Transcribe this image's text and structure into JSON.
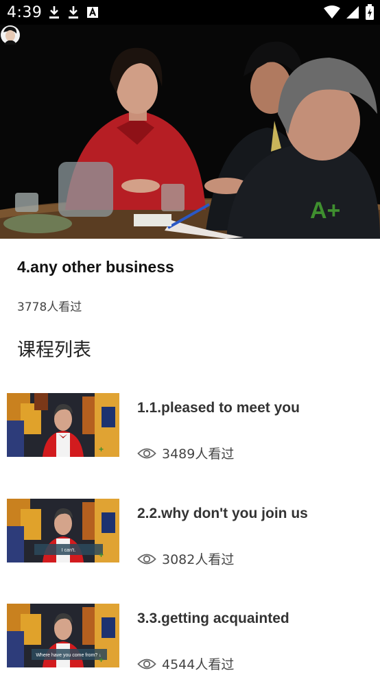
{
  "status_bar": {
    "time": "4:39",
    "left_icons": [
      "download-icon",
      "download-icon",
      "text-app-icon"
    ],
    "right_icons": [
      "wifi-icon",
      "signal-icon",
      "battery-icon"
    ]
  },
  "video": {
    "watermark": "A+"
  },
  "course": {
    "title": "4.any other business",
    "views": "3778人看过"
  },
  "section": {
    "title": "课程列表"
  },
  "lessons": [
    {
      "title": "1.1.pleased to meet you",
      "views": "3489人看过",
      "caption": ""
    },
    {
      "title": "2.2.why don't you join us",
      "views": "3082人看过",
      "caption": "I can't."
    },
    {
      "title": "3.3.getting acquainted",
      "views": "4544人看过",
      "caption": "Where have you come from? ↓"
    }
  ],
  "colors": {
    "status_bar": "#000000",
    "background": "#ffffff",
    "title": "#111111",
    "watermark": "#3f8f2f"
  }
}
